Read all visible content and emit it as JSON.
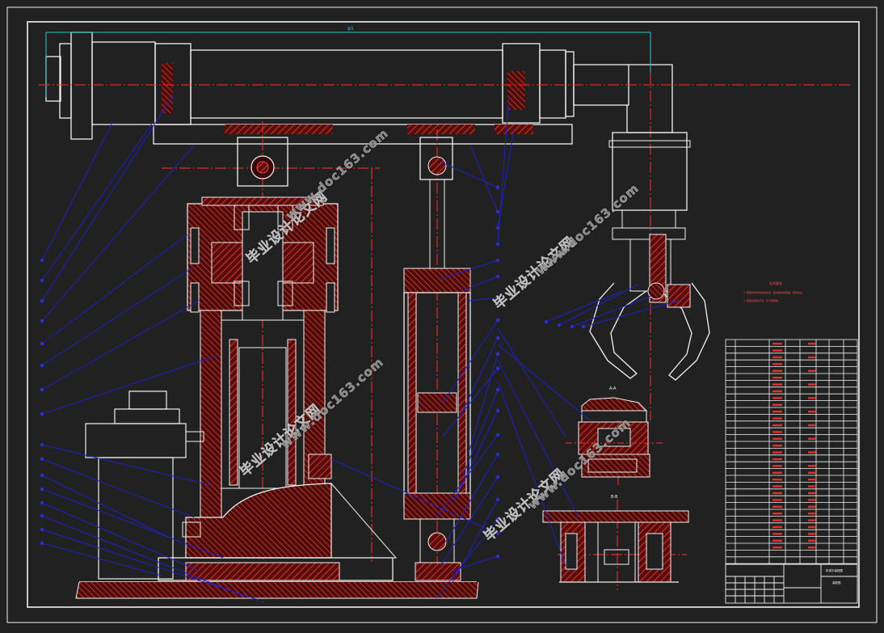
{
  "drawing": {
    "title_block_name": "机械手装配图",
    "title_block_sub": "装配图",
    "section_a_label": "A-A",
    "section_b_label": "B-B",
    "dimension_label": "φ1"
  },
  "notes": {
    "heading": "技术要求",
    "line1": "1. 装配前零件用煤油清洗，配合面涂润滑油，密封良好。",
    "line2": "2. 装配后运动灵活，无卡滞现象。"
  },
  "watermarks": [
    {
      "text": "毕业设计论文网"
    },
    {
      "text": "www.doc163.com"
    }
  ],
  "colors": {
    "background": "#212121",
    "outline": "#ffffff",
    "section_hatch": "#c0392b",
    "centerline": "#ff2a2a",
    "leader": "#1d22c8",
    "dimension": "#21c9d6"
  }
}
